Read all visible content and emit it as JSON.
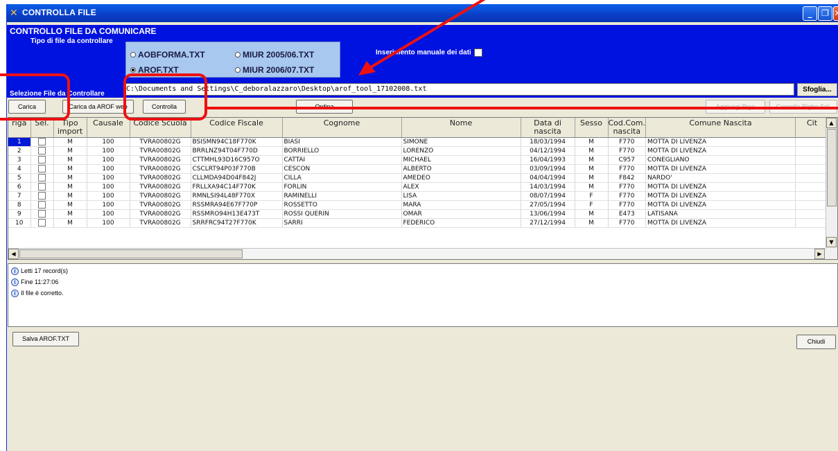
{
  "window": {
    "title": "CONTROLLA FILE"
  },
  "titlebar_buttons": {
    "minimize": "_",
    "maximize": "❐",
    "close": "✕"
  },
  "panel": {
    "title": "CONTROLLO FILE DA COMUNICARE",
    "tipo_label": "Tipo di file da controllare",
    "radios": [
      {
        "label": "AOBFORMA.TXT",
        "checked": false
      },
      {
        "label": "MIUR 2005/06.TXT",
        "checked": false
      },
      {
        "label": "AROF.TXT",
        "checked": true
      },
      {
        "label": "MIUR 2006/07.TXT",
        "checked": false
      }
    ],
    "manual_label": "Inserimento manuale dei dati",
    "selezione_label": "Selezione File da Controllare",
    "file_path": "C:\\Documents and Settings\\C_deboralazzaro\\Desktop\\arof_tool_17102008.txt",
    "sfoglia_label": "Sfoglia..."
  },
  "buttons": {
    "carica": "Carica",
    "carica_web": "Carica da AROF web",
    "controlla": "Controlla",
    "ordina": "Ordina",
    "aggiungi": "Aggiungi Riga",
    "cancella": "Cancella Righe Sel."
  },
  "grid": {
    "columns": [
      "riga",
      "Sel.",
      "Tipo\nimport",
      "Causale",
      "Codice Scuola",
      "Codice Fiscale",
      "Cognome",
      "Nome",
      "Data di\nnascita",
      "Sesso",
      "Cod.Com.\nnascita",
      "Comune Nascita",
      "Cit"
    ],
    "rows": [
      [
        "1",
        "",
        "M",
        "100",
        "TVRA00802G",
        "BSISMN94C18F770K",
        "BIASI",
        "SIMONE",
        "18/03/1994",
        "M",
        "F770",
        "MOTTA DI LIVENZA"
      ],
      [
        "2",
        "",
        "M",
        "100",
        "TVRA00802G",
        "BRRLNZ94T04F770D",
        "BORRIELLO",
        "LORENZO",
        "04/12/1994",
        "M",
        "F770",
        "MOTTA DI LIVENZA"
      ],
      [
        "3",
        "",
        "M",
        "100",
        "TVRA00802G",
        "CTTMHL93D16C957O",
        "CATTAI",
        "MICHAEL",
        "16/04/1993",
        "M",
        "C957",
        "CONEGLIANO"
      ],
      [
        "4",
        "",
        "M",
        "100",
        "TVRA00802G",
        "CSCLRT94P03F770B",
        "CESCON",
        "ALBERTO",
        "03/09/1994",
        "M",
        "F770",
        "MOTTA DI LIVENZA"
      ],
      [
        "5",
        "",
        "M",
        "100",
        "TVRA00802G",
        "CLLMDA94D04F842J",
        "CILLA",
        "AMEDEO",
        "04/04/1994",
        "M",
        "F842",
        "NARDO'"
      ],
      [
        "6",
        "",
        "M",
        "100",
        "TVRA00802G",
        "FRLLXA94C14F770K",
        "FORLIN",
        "ALEX",
        "14/03/1994",
        "M",
        "F770",
        "MOTTA DI LIVENZA"
      ],
      [
        "7",
        "",
        "M",
        "100",
        "TVRA00802G",
        "RMNLSI94L48F770X",
        "RAMINELLI",
        "LISA",
        "08/07/1994",
        "F",
        "F770",
        "MOTTA DI LIVENZA"
      ],
      [
        "8",
        "",
        "M",
        "100",
        "TVRA00802G",
        "RSSMRA94E67F770P",
        "ROSSETTO",
        "MARA",
        "27/05/1994",
        "F",
        "F770",
        "MOTTA DI LIVENZA"
      ],
      [
        "9",
        "",
        "M",
        "100",
        "TVRA00802G",
        "RSSMRO94H13E473T",
        "ROSSI QUERIN",
        "OMAR",
        "13/06/1994",
        "M",
        "E473",
        "LATISANA"
      ],
      [
        "10",
        "",
        "M",
        "100",
        "TVRA00802G",
        "SRRFRC94T27F770K",
        "SARRI",
        "FEDERICO",
        "27/12/1994",
        "M",
        "F770",
        "MOTTA DI LIVENZA"
      ]
    ]
  },
  "log": [
    "Letti 17 record(s)",
    "Fine 11:27:06",
    "Il file è corretto."
  ],
  "bottom_buttons": {
    "salva": "Salva AROF.TXT",
    "chiudi": "Chiudi"
  },
  "colors": {
    "panel_blue": "#0012e0",
    "annotation_red": "#ee1111",
    "selected_row": "#0018d8"
  },
  "icons": {
    "app": "tools-icon",
    "info": "info-icon"
  }
}
